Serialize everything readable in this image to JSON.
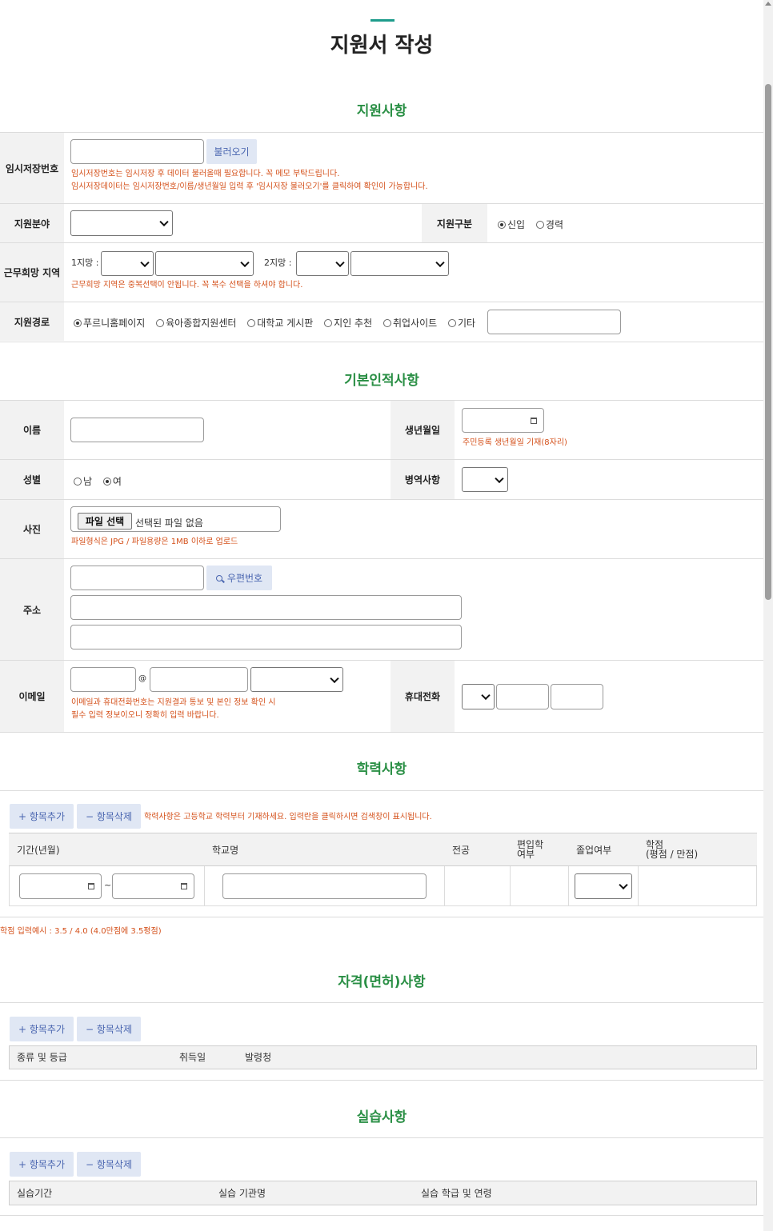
{
  "page_title": "지원서 작성",
  "sections": {
    "apply": "지원사항",
    "basic": "기본인적사항",
    "education": "학력사항",
    "license": "자격(면허)사항",
    "practice": "실습사항"
  },
  "apply": {
    "temp_label": "임시저장번호",
    "load_button": "불러오기",
    "temp_note1": "임시저장번호는 임시저장 후 데이터 불러올때 필요합니다. 꼭 메모 부탁드립니다.",
    "temp_note2": "임시저장데이터는 임시저장번호/이름/생년월일 입력 후 '임시저장 불러오기'를 클릭하여 확인이 가능합니다.",
    "field_label": "지원분야",
    "type_label": "지원구분",
    "type_options": [
      "신입",
      "경력"
    ],
    "region_label": "근무희망 지역",
    "choice1": "1지망 :",
    "choice2": "2지망 :",
    "region_note": "근무희망 지역은 중복선택이 안됩니다. 꼭 복수 선택을 하셔야 합니다.",
    "route_label": "지원경로",
    "route_options": [
      "푸르니홈페이지",
      "육아종합지원센터",
      "대학교 게시판",
      "지인 추천",
      "취업사이트",
      "기타"
    ]
  },
  "basic": {
    "name_label": "이름",
    "birth_label": "생년월일",
    "birth_note": "주민등록 생년월일 기재(8자리)",
    "gender_label": "성별",
    "gender_options": [
      "남",
      "여"
    ],
    "military_label": "병역사항",
    "photo_label": "사진",
    "file_button": "파일 선택",
    "file_status": "선택된 파일 없음",
    "photo_note": "파일형식은 JPG / 파일용량은 1MB 이하로 업로드",
    "address_label": "주소",
    "zip_button": "우편번호",
    "email_label": "이메일",
    "at": "@",
    "email_note1": "이메일과 휴대전화번호는 지원결과 통보 및 본인 정보 확인 시",
    "email_note2": "필수 입력 정보이오니 정확히 입력 바랍니다.",
    "phone_label": "휴대전화"
  },
  "buttons": {
    "add": "+ 항목추가",
    "remove": "− 항목삭제"
  },
  "education": {
    "note": "학력사항은 고등학교 학력부터 기재하세요. 입력란을 클릭하시면 검색창이 표시됩니다.",
    "headers": [
      "기간(년월)",
      "학교명",
      "전공",
      "편입학\n여부",
      "졸업여부",
      "학점\n(평점 / 만점)"
    ],
    "tilde": "~",
    "grade_note": "학점 입력예시 : 3.5 / 4.0 (4.0만점에 3.5평점)"
  },
  "license": {
    "headers": [
      "종류 및 등급",
      "취득일",
      "발령청"
    ]
  },
  "practice": {
    "headers": [
      "실습기간",
      "실습 기관명",
      "실습 학급 및 연령"
    ]
  }
}
